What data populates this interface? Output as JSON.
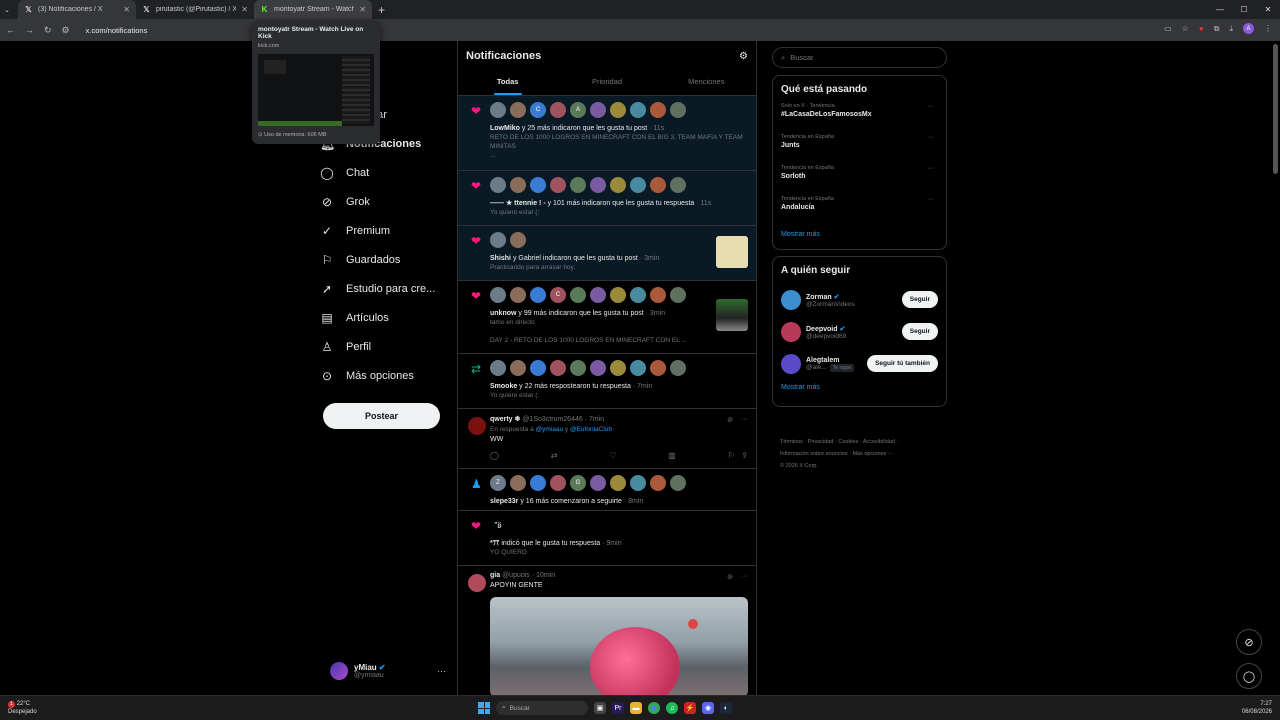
{
  "browser": {
    "tabs": [
      {
        "icon": "x-logo-icon",
        "title": "(3) Notificaciones / X"
      },
      {
        "icon": "x-logo-icon",
        "title": "pirutastic (@Pirutastic) / X"
      },
      {
        "icon": "kick-logo-icon",
        "title": "montoyatr Stream - Watch Li..."
      }
    ],
    "url": "x.com/notifications",
    "tooltip": {
      "title": "montoyatr Stream - Watch Live on Kick",
      "url": "kick.com",
      "memory": "Uso de memoria: 606 MB"
    },
    "profile_initial": "A"
  },
  "leftnav": {
    "items": [
      {
        "icon": "search-icon",
        "label": "Explorar"
      },
      {
        "icon": "bell-icon",
        "label": "Notificaciones"
      },
      {
        "icon": "chat-icon",
        "label": "Chat"
      },
      {
        "icon": "grok-icon",
        "label": "Grok"
      },
      {
        "icon": "premium-icon",
        "label": "Premium"
      },
      {
        "icon": "bookmark-icon",
        "label": "Guardados"
      },
      {
        "icon": "rocket-icon",
        "label": "Estudio para cre..."
      },
      {
        "icon": "article-icon",
        "label": "Artículos"
      },
      {
        "icon": "person-icon",
        "label": "Perfil"
      },
      {
        "icon": "more-circle-icon",
        "label": "Más opciones"
      }
    ],
    "post_button": "Postear",
    "profile": {
      "name": "yMiau",
      "handle": "@ymiaau"
    }
  },
  "main": {
    "title": "Notificaciones",
    "tabs": [
      "Todas",
      "Prioridad",
      "Menciones"
    ],
    "notifications": [
      {
        "kind": "like",
        "avatars": [
          "",
          "",
          "C",
          "",
          "A",
          "",
          "",
          "",
          "",
          ""
        ],
        "actor": "LowMiko",
        "text": " y 25 más indicaron que les gusta tu post",
        "time": " · 11s",
        "sub": "RETO DE LOS 1000 LOGROS EN MINECRAFT CON EL BIG 3, TEAM MAFIA Y TEAM MINITAS",
        "sub2": "..."
      },
      {
        "kind": "like",
        "avatars": [
          "",
          "",
          "",
          "",
          "",
          "",
          "",
          "",
          "",
          ""
        ],
        "actor": "—— ★ ttennie ! -",
        "text": " y 101 más indicaron que les gusta tu respuesta",
        "time": " · 11s",
        "sub": "Yo quiero estar (:"
      },
      {
        "kind": "like",
        "avatars": [
          "",
          ""
        ],
        "actor": "Shishi",
        "text": " y Gabriel indicaron que les gusta tu post",
        "time": " · 3min",
        "sub": "Practicando para arrasar hoy."
      },
      {
        "kind": "like",
        "avatars": [
          "",
          "",
          "",
          "C",
          "",
          "",
          "",
          "",
          "",
          ""
        ],
        "actor": "unknow",
        "text": " y 99 más indicaron que les gusta tu post",
        "time": " · 3min",
        "sub": "tamo en directo",
        "sub2": "DAY 2 - RETO DE LOS 1000 LOGROS EN MINECRAFT CON EL ..."
      },
      {
        "kind": "repost",
        "avatars": [
          "",
          "",
          "",
          "",
          "",
          "",
          "",
          "",
          "",
          ""
        ],
        "actor": "Smooke",
        "text": " y 22 más respostearon tu respuesta",
        "time": " · 7min",
        "sub": "Yo quiero estar (:"
      }
    ],
    "reply_post": {
      "name": "qwerty ❄",
      "handle": "@1So3ctrum26446",
      "time": "· 7min",
      "reply_prefix": "En respuesta a",
      "reply_to_1": "@ymiaau",
      "reply_and": " y ",
      "reply_to_2": "@EufonlaClub",
      "body": "WW"
    },
    "follow_notif": {
      "avatars": [
        "Z",
        "",
        "",
        "",
        "G",
        "",
        "",
        "",
        "",
        ""
      ],
      "actor": "slepe33r",
      "text": " y 16 más comenzaron a seguirte",
      "time": " · 8min"
    },
    "single_like": {
      "actor_line": "\"ʚ̈",
      "actor": "*ꔫ",
      "text": " indicó que le gusta tu respuesta",
      "time": " · 9min",
      "sub": "YO QUIERO"
    },
    "media_post": {
      "name": "gia",
      "handle": "@upuois",
      "time": "· 10min",
      "body": "APOYIN GENTE"
    }
  },
  "right": {
    "search_placeholder": "Buscar",
    "trending_title": "Qué está pasando",
    "trends": [
      {
        "context": "Solo en X · Tendencia",
        "name": "#LaCasaDeLosFamososMx"
      },
      {
        "context": "Tendencia en España",
        "name": "Junts"
      },
      {
        "context": "Tendencia en España",
        "name": "Sorloth"
      },
      {
        "context": "Tendencia en España",
        "name": "Andalucía"
      }
    ],
    "show_more": "Mostrar más",
    "follow_title": "A quién seguir",
    "follow": [
      {
        "name": "Zorman",
        "handle": "@ZormanVideos",
        "button": "Seguir",
        "color": "#3b8fd1"
      },
      {
        "name": "Deepvoid",
        "handle": "@deepvoid69",
        "button": "Seguir",
        "color": "#b83a5a"
      },
      {
        "name": "Alegtalem",
        "handle": "@ale...",
        "button": "Seguir tú también",
        "tag": "Te sigue",
        "color": "#5a4ac8"
      }
    ],
    "footer": {
      "l1": "Términos · Privacidad · Cookies · Accesibilidad ·",
      "l2": "Información sobre anuncios · Más opciones ···",
      "l3": "© 2026 X Corp."
    }
  },
  "taskbar": {
    "temp": "22°C",
    "weather": "Despejado",
    "badge": "1",
    "search": "Buscar",
    "time": "7:27",
    "date": "06/08/2026"
  },
  "colors": {
    "accent": "#1d9bf0",
    "like": "#f91880",
    "repost": "#00ba7c"
  }
}
